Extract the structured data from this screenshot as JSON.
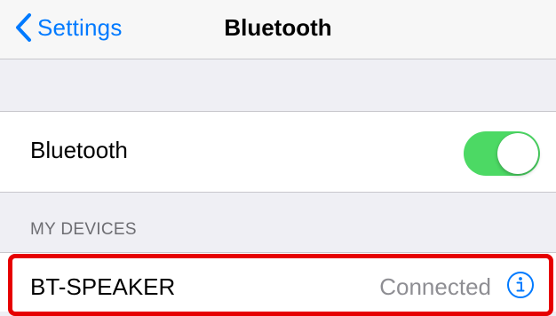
{
  "navbar": {
    "back_label": "Settings",
    "back_icon": "chevron-left-icon",
    "title": "Bluetooth"
  },
  "bluetooth_row": {
    "label": "Bluetooth",
    "toggle_on": true
  },
  "devices_section": {
    "header": "MY DEVICES",
    "devices": [
      {
        "name": "BT-SPEAKER",
        "status": "Connected",
        "info_icon": "info-icon"
      }
    ]
  },
  "colors": {
    "accent": "#007aff",
    "toggle_on": "#4cd964",
    "highlight": "#e60000",
    "background": "#efeff4",
    "secondary_text": "#8e8e93"
  }
}
